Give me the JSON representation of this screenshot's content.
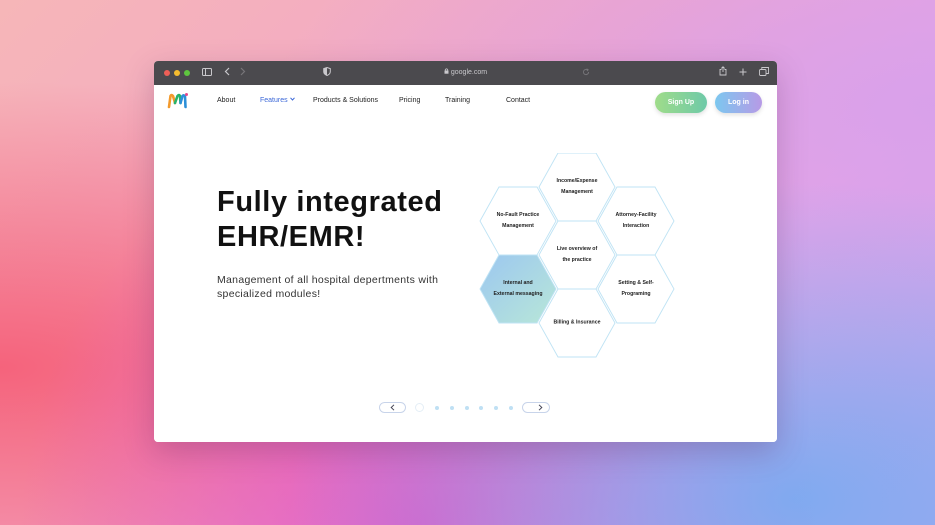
{
  "browser": {
    "url": "google.com",
    "icons": {
      "sidebar": "sidebar-icon",
      "back": "back-icon",
      "forward": "forward-icon",
      "shield": "shield-icon",
      "lock": "lock-icon",
      "reload": "reload-icon",
      "share": "share-icon",
      "new_tab": "plus-icon",
      "tabs": "tabs-overview-icon"
    },
    "traffic_lights": [
      "#ee5f57",
      "#f5bc2f",
      "#5ec63f"
    ]
  },
  "nav": {
    "logo_icon": "logo-m-icon",
    "items": [
      "About",
      "Features",
      "Products & Solutions",
      "Pricing",
      "Training",
      "Contact"
    ],
    "active_index": 1,
    "signup_label": "Sign Up",
    "login_label": "Log in"
  },
  "hero": {
    "title_line1": "Fully integrated",
    "title_line2": "EHR/EMR!",
    "subtitle": "Management of all hospital depertments with specialized modules!"
  },
  "modules": [
    {
      "line1": "Income/Expense",
      "line2": "Management"
    },
    {
      "line1": "No-Fault Practice",
      "line2": "Management"
    },
    {
      "line1": "Attorney-Facility",
      "line2": "Interaction"
    },
    {
      "line1": "Live overview of",
      "line2": "the practice"
    },
    {
      "line1": "Internal and",
      "line2": "External messaging"
    },
    {
      "line1": "Setting & Self-",
      "line2": "Programing"
    },
    {
      "line1": "Billing & Insurance",
      "line2": ""
    }
  ],
  "carousel": {
    "prev_icon": "chevron-left-icon",
    "next_icon": "chevron-right-icon",
    "dot_count": 7,
    "active_dot": 0
  },
  "colors": {
    "signup_gradient": [
      "#9fdc8a",
      "#6ec9a8"
    ],
    "login_gradient": [
      "#7cc7ef",
      "#b79ae6"
    ],
    "hex_stroke": "#bfe3f4",
    "active_hex": [
      "#9cc7f0",
      "#b8e7d8"
    ],
    "nav_active": "#3c68d8"
  }
}
